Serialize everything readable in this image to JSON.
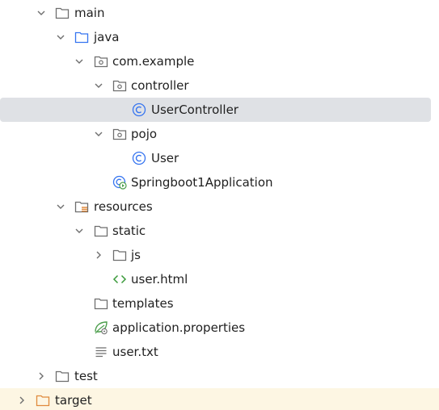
{
  "tree": {
    "main": "main",
    "java": "java",
    "com_example": "com.example",
    "controller": "controller",
    "user_controller": "UserController",
    "pojo": "pojo",
    "user": "User",
    "springboot_app": "Springboot1Application",
    "resources": "resources",
    "static": "static",
    "js": "js",
    "user_html": "user.html",
    "templates": "templates",
    "application_properties": "application.properties",
    "user_txt": "user.txt",
    "test": "test",
    "target": "target"
  },
  "colors": {
    "selected_row": "#dfe1e5",
    "target_row": "#fdf6e3",
    "folder_gray": "#6e6e6e",
    "folder_blue": "#3574f0",
    "folder_orange": "#e08a3c",
    "class_blue": "#3574f0",
    "html_green": "#3a9a3a",
    "spring_green": "#4c9e4c"
  }
}
